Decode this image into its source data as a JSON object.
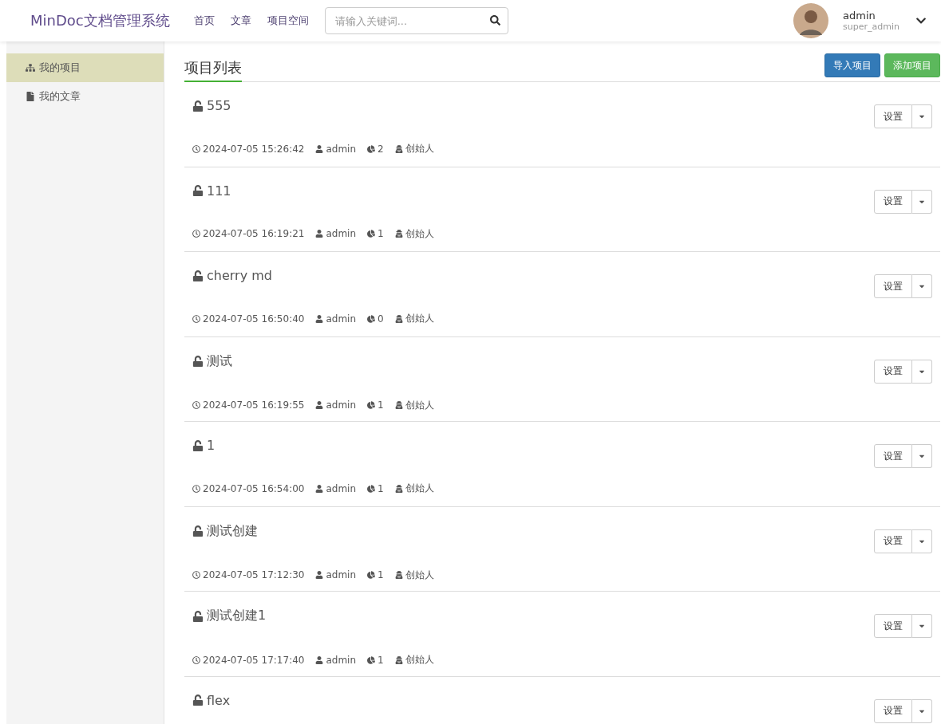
{
  "header": {
    "logo": "MinDoc文档管理系统",
    "nav": [
      {
        "label": "首页"
      },
      {
        "label": "文章"
      },
      {
        "label": "项目空间"
      }
    ],
    "search": {
      "placeholder": "请输入关键词..."
    },
    "user": {
      "name": "admin",
      "role": "super_admin"
    }
  },
  "sidebar": {
    "items": [
      {
        "label": "我的项目",
        "kind": "sitemap",
        "selected": true
      },
      {
        "label": "我的文章",
        "kind": "file",
        "selected": false
      }
    ]
  },
  "main": {
    "title": "项目列表",
    "buttons": [
      {
        "label": "导入项目",
        "kind": "primary"
      },
      {
        "label": "添加项目",
        "kind": "success"
      }
    ],
    "projects": [
      {
        "name": "555",
        "time": "2024-07-05 15:26:42",
        "author": "admin",
        "docs": "2",
        "role": "创始人",
        "button": "设置"
      },
      {
        "name": "111",
        "time": "2024-07-05 16:19:21",
        "author": "admin",
        "docs": "1",
        "role": "创始人",
        "button": "设置"
      },
      {
        "name": "cherry md",
        "time": "2024-07-05 16:50:40",
        "author": "admin",
        "docs": "0",
        "role": "创始人",
        "button": "设置"
      },
      {
        "name": "测试",
        "time": "2024-07-05 16:19:55",
        "author": "admin",
        "docs": "1",
        "role": "创始人",
        "button": "设置"
      },
      {
        "name": "1",
        "time": "2024-07-05 16:54:00",
        "author": "admin",
        "docs": "1",
        "role": "创始人",
        "button": "设置"
      },
      {
        "name": "测试创建",
        "time": "2024-07-05 17:12:30",
        "author": "admin",
        "docs": "1",
        "role": "创始人",
        "button": "设置"
      },
      {
        "name": "测试创建1",
        "time": "2024-07-05 17:17:40",
        "author": "admin",
        "docs": "1",
        "role": "创始人",
        "button": "设置"
      },
      {
        "name": "flex",
        "button": "设置"
      }
    ]
  }
}
